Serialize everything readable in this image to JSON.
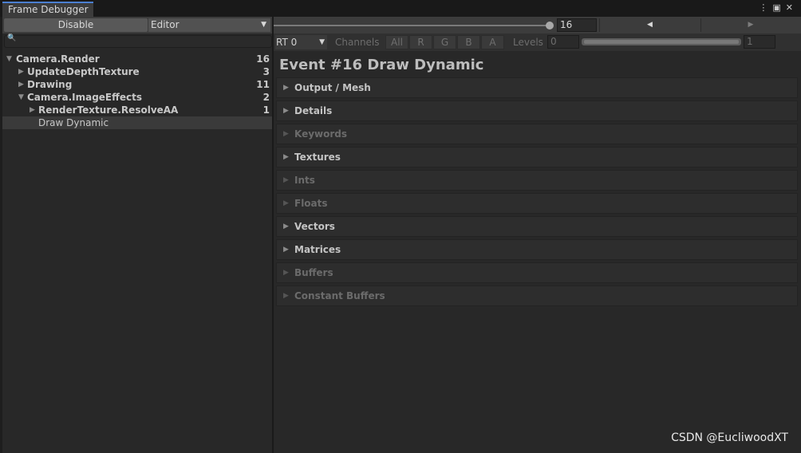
{
  "window": {
    "tab_title": "Frame Debugger"
  },
  "left_panel": {
    "toolbar": {
      "disable_label": "Disable",
      "target_dropdown_value": "Editor"
    },
    "search": {
      "placeholder": ""
    },
    "tree": [
      {
        "label": "Camera.Render",
        "count": "16",
        "expanded": true
      },
      {
        "label": "UpdateDepthTexture",
        "count": "3",
        "expanded": false
      },
      {
        "label": "Drawing",
        "count": "11",
        "expanded": false
      },
      {
        "label": "Camera.ImageEffects",
        "count": "2",
        "expanded": true
      },
      {
        "label": "RenderTexture.ResolveAA",
        "count": "1",
        "expanded": false
      },
      {
        "label": "Draw Dynamic",
        "count": "",
        "selected": true
      }
    ]
  },
  "right_panel": {
    "event_number": "16",
    "rt_dropdown_value": "RT 0",
    "channels_label": "Channels",
    "channel_buttons": [
      "All",
      "R",
      "G",
      "B",
      "A"
    ],
    "levels_label": "Levels",
    "levels_min": "0",
    "levels_max": "1",
    "event_title": "Event #16 Draw Dynamic",
    "sections": [
      {
        "label": "Output / Mesh",
        "enabled": true
      },
      {
        "label": "Details",
        "enabled": true
      },
      {
        "label": "Keywords",
        "enabled": false
      },
      {
        "label": "Textures",
        "enabled": true
      },
      {
        "label": "Ints",
        "enabled": false
      },
      {
        "label": "Floats",
        "enabled": false
      },
      {
        "label": "Vectors",
        "enabled": true
      },
      {
        "label": "Matrices",
        "enabled": true
      },
      {
        "label": "Buffers",
        "enabled": false
      },
      {
        "label": "Constant Buffers",
        "enabled": false
      }
    ]
  },
  "watermark": "CSDN @EucliwoodXT",
  "colors": {
    "background": "#282828",
    "toolbar": "#3c3c3c",
    "tab_accent": "#4b7fd1"
  }
}
